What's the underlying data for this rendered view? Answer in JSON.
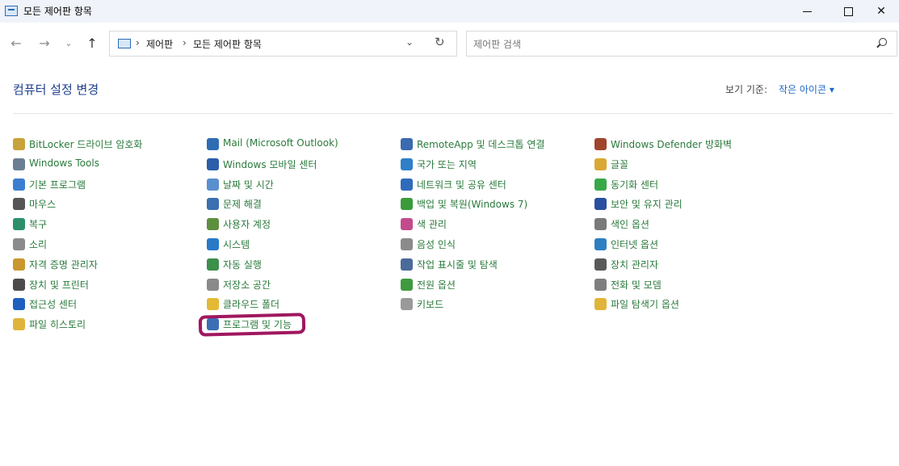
{
  "window": {
    "title": "모든 제어판 항목"
  },
  "nav": {
    "back": "←",
    "forward": "→",
    "recent": "⌄",
    "up": "↑",
    "breadcrumb": [
      "제어판",
      "모든 제어판 항목"
    ],
    "separator": "›",
    "dropdown": "⌄",
    "refresh": "↻"
  },
  "search": {
    "placeholder": "제어판 검색"
  },
  "header": {
    "title": "컴퓨터 설정 변경",
    "view_by_label": "보기 기준:",
    "view_by_value": "작은 아이콘 ▾"
  },
  "columns": [
    [
      {
        "label": "BitLocker 드라이브 암호화",
        "icon": "bitlocker-icon",
        "color": "#c8a23a"
      },
      {
        "label": "Windows Tools",
        "icon": "windows-tools-icon",
        "color": "#6a7f93"
      },
      {
        "label": "기본 프로그램",
        "icon": "default-programs-icon",
        "color": "#3b7ed1"
      },
      {
        "label": "마우스",
        "icon": "mouse-icon",
        "color": "#555555"
      },
      {
        "label": "복구",
        "icon": "recovery-icon",
        "color": "#2c8f6a"
      },
      {
        "label": "소리",
        "icon": "sound-icon",
        "color": "#8b8b8b"
      },
      {
        "label": "자격 증명 관리자",
        "icon": "credential-manager-icon",
        "color": "#c9972c"
      },
      {
        "label": "장치 및 프린터",
        "icon": "devices-printers-icon",
        "color": "#4c4c4c"
      },
      {
        "label": "접근성 센터",
        "icon": "ease-of-access-icon",
        "color": "#1f5fbf"
      },
      {
        "label": "파일 히스토리",
        "icon": "file-history-icon",
        "color": "#e0b43a"
      }
    ],
    [
      {
        "label": "Mail (Microsoft Outlook)",
        "icon": "mail-icon",
        "color": "#2e6db4"
      },
      {
        "label": "Windows 모바일 센터",
        "icon": "mobility-center-icon",
        "color": "#2a5ea8"
      },
      {
        "label": "날짜 및 시간",
        "icon": "date-time-icon",
        "color": "#5a8fcf"
      },
      {
        "label": "문제 해결",
        "icon": "troubleshooting-icon",
        "color": "#3a6fb0"
      },
      {
        "label": "사용자 계정",
        "icon": "user-accounts-icon",
        "color": "#5e8f3f"
      },
      {
        "label": "시스템",
        "icon": "system-icon",
        "color": "#2a7ac7"
      },
      {
        "label": "자동 실행",
        "icon": "autoplay-icon",
        "color": "#3d8f4c"
      },
      {
        "label": "저장소 공간",
        "icon": "storage-spaces-icon",
        "color": "#8a8a8a"
      },
      {
        "label": "클라우드 폴더",
        "icon": "cloud-folder-icon",
        "color": "#e4b935"
      },
      {
        "label": "프로그램 및 기능",
        "icon": "programs-features-icon",
        "color": "#3b6fb5"
      }
    ],
    [
      {
        "label": "RemoteApp 및 데스크톱 연결",
        "icon": "remoteapp-icon",
        "color": "#3a6ab0"
      },
      {
        "label": "국가 또는 지역",
        "icon": "region-icon",
        "color": "#2f7fc9"
      },
      {
        "label": "네트워크 및 공유 센터",
        "icon": "network-sharing-icon",
        "color": "#2f6bbb"
      },
      {
        "label": "백업 및 복원(Windows 7)",
        "icon": "backup-restore-icon",
        "color": "#3b9b3b"
      },
      {
        "label": "색 관리",
        "icon": "color-management-icon",
        "color": "#c44a8e"
      },
      {
        "label": "음성 인식",
        "icon": "speech-recognition-icon",
        "color": "#8b8b8b"
      },
      {
        "label": "작업 표시줄 및 탐색",
        "icon": "taskbar-navigation-icon",
        "color": "#4a6a9a"
      },
      {
        "label": "전원 옵션",
        "icon": "power-options-icon",
        "color": "#3f9b3f"
      },
      {
        "label": "키보드",
        "icon": "keyboard-icon",
        "color": "#9a9a9a"
      }
    ],
    [
      {
        "label": "Windows Defender 방화벽",
        "icon": "firewall-icon",
        "color": "#a0442c"
      },
      {
        "label": "글꼴",
        "icon": "fonts-icon",
        "color": "#d9a933"
      },
      {
        "label": "동기화 센터",
        "icon": "sync-center-icon",
        "color": "#38a848"
      },
      {
        "label": "보안 및 유지 관리",
        "icon": "security-maintenance-icon",
        "color": "#2a4fa0"
      },
      {
        "label": "색인 옵션",
        "icon": "indexing-options-icon",
        "color": "#7a7a7a"
      },
      {
        "label": "인터넷 옵션",
        "icon": "internet-options-icon",
        "color": "#2d7fc2"
      },
      {
        "label": "장치 관리자",
        "icon": "device-manager-icon",
        "color": "#5a5a5a"
      },
      {
        "label": "전화 및 모뎀",
        "icon": "phone-modem-icon",
        "color": "#7f7f7f"
      },
      {
        "label": "파일 탐색기 옵션",
        "icon": "file-explorer-options-icon",
        "color": "#e0b43a"
      }
    ]
  ],
  "window_controls": {
    "close": "✕"
  }
}
